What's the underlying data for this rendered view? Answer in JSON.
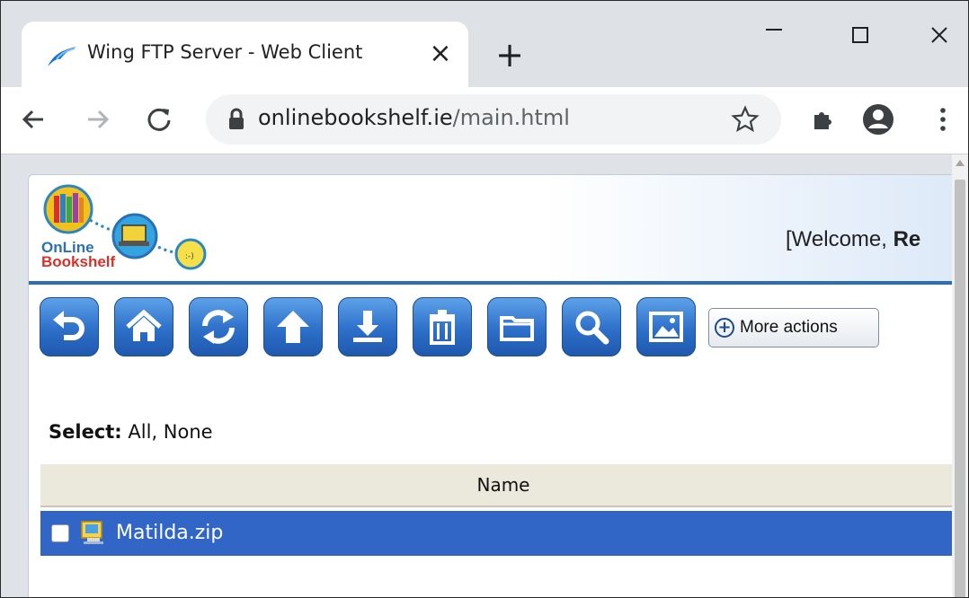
{
  "browser": {
    "tab": {
      "title": "Wing FTP Server - Web Client",
      "close": "×"
    },
    "new_tab": "+",
    "url": {
      "host": "onlinebookshelf.ie",
      "path": "/main.html"
    }
  },
  "app": {
    "logo": {
      "line1": "OnLine",
      "line2": "Bookshelf"
    },
    "welcome": {
      "prefix": "[Welcome, ",
      "user": "Re"
    },
    "toolbar_icons": [
      "back-icon",
      "home-icon",
      "refresh-icon",
      "upload-icon",
      "download-icon",
      "delete-icon",
      "new-folder-icon",
      "search-icon",
      "thumbnail-icon"
    ],
    "more_actions_label": "More actions",
    "select": {
      "label": "Select:",
      "all": "All",
      "separator": ", ",
      "none": "None"
    },
    "table": {
      "columns": [
        "Name"
      ],
      "rows": [
        {
          "name": "Matilda.zip",
          "selected": true,
          "checked": false
        }
      ]
    }
  },
  "colors": {
    "accent": "#2e6db4",
    "selected_row": "#3166c7",
    "header_bg": "#ebe9dc"
  }
}
